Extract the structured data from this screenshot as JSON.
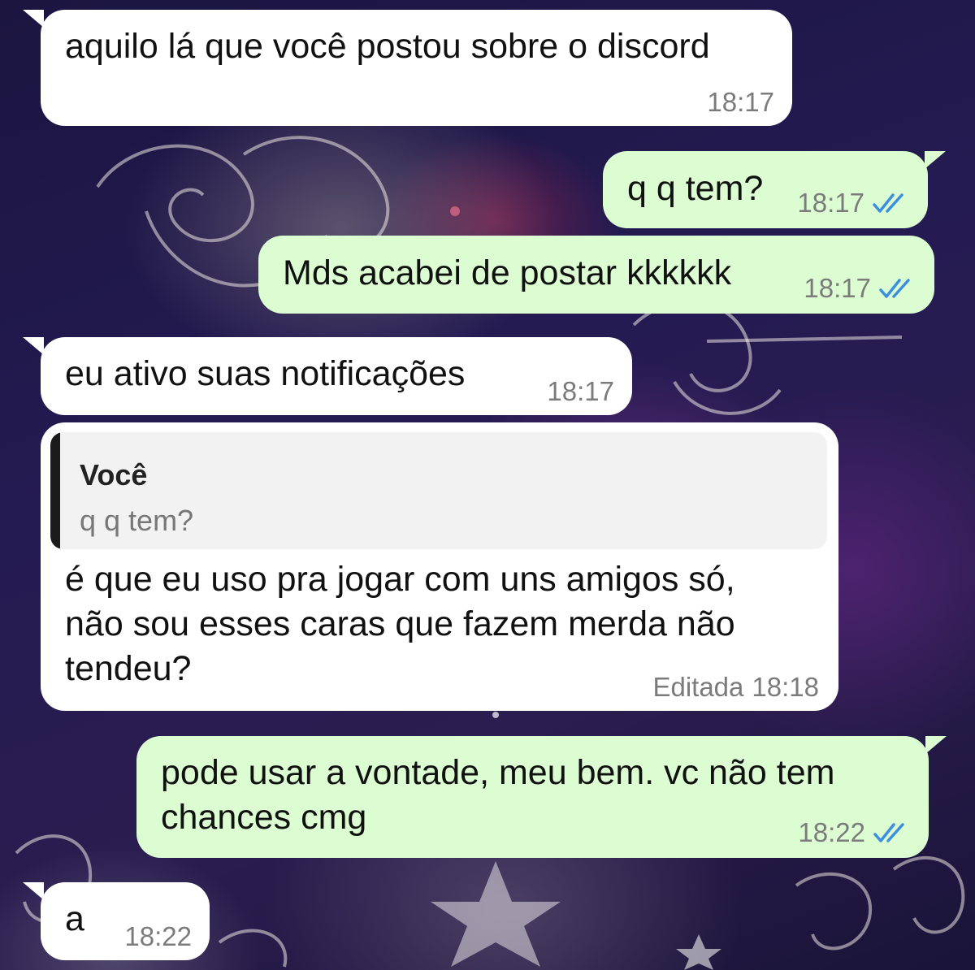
{
  "accent_colors": {
    "incoming_bubble": "#ffffff",
    "outgoing_bubble": "#dcfdd2",
    "read_ticks": "#3c8fe0",
    "timestamp": "#7b7b7b",
    "quote_bar": "#1b1b1b"
  },
  "messages": [
    {
      "direction": "in",
      "text": "aquilo lá que você postou sobre o discord",
      "time": "18:17"
    },
    {
      "direction": "out",
      "text": "q q tem?",
      "time": "18:17",
      "status_icon": "double-check-icon"
    },
    {
      "direction": "out",
      "text": "Mds acabei de postar kkkkkk",
      "time": "18:17",
      "status_icon": "double-check-icon"
    },
    {
      "direction": "in",
      "text": "eu ativo suas notificações",
      "time": "18:17"
    },
    {
      "direction": "in",
      "quote": {
        "author": "Você",
        "text": "q q tem?"
      },
      "lines": [
        "é que eu uso pra jogar com uns amigos só,",
        "não sou esses caras que fazem merda não",
        "tendeu?"
      ],
      "edited_label": "Editada",
      "time": "18:18"
    },
    {
      "direction": "out",
      "lines": [
        "pode usar a vontade, meu bem. vc não tem",
        "chances cmg"
      ],
      "time": "18:22",
      "status_icon": "double-check-icon"
    },
    {
      "direction": "in",
      "text": "a",
      "time": "18:22"
    }
  ]
}
